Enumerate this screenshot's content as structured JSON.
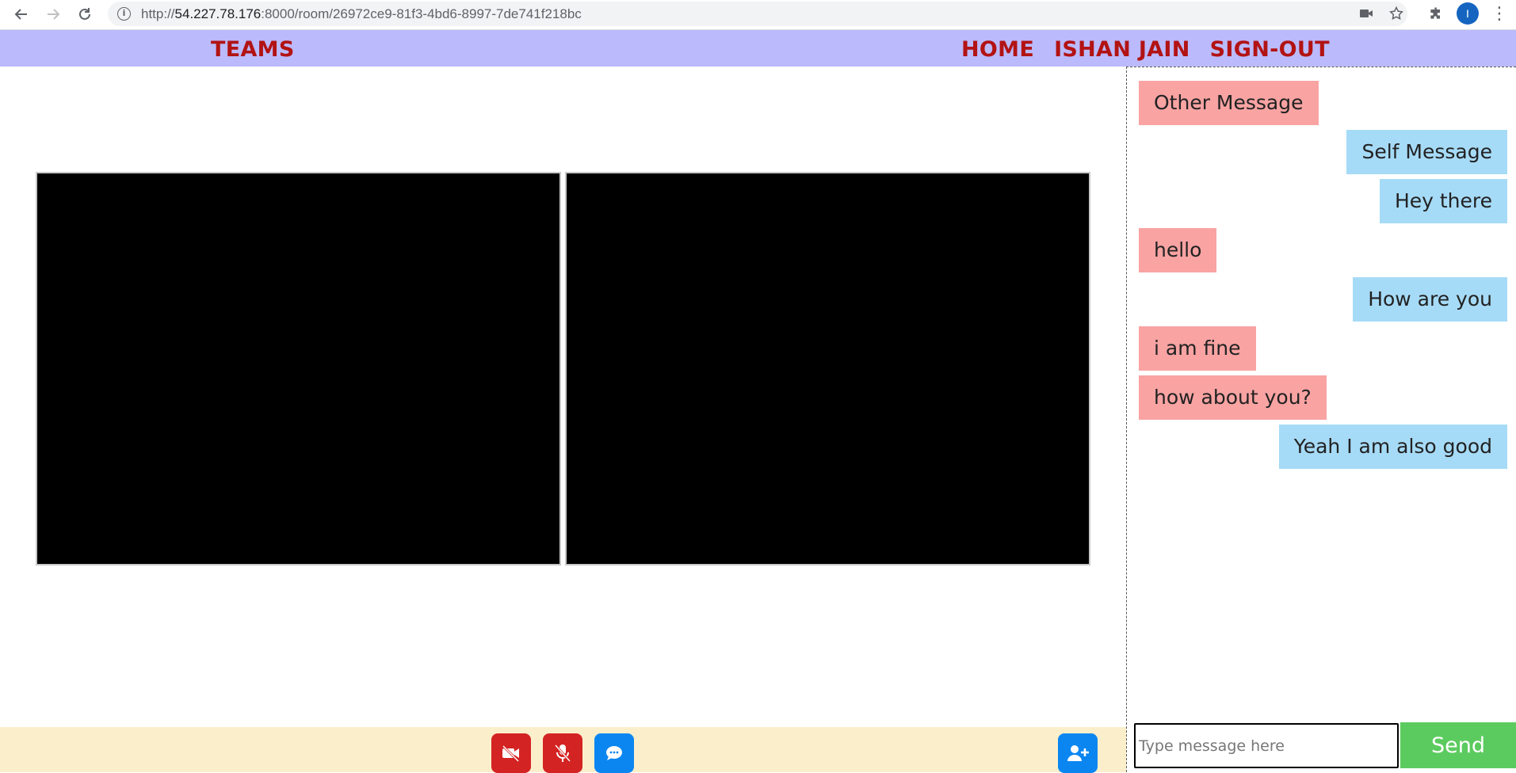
{
  "browser": {
    "url_protocol": "http://",
    "url_host": "54.227.78.176",
    "url_rest": ":8000/room/26972ce9-81f3-4bd6-8997-7de741f218bc",
    "profile_initial": "I",
    "icons": [
      "back-icon",
      "forward-icon",
      "reload-icon",
      "info-icon",
      "camera-icon",
      "star-icon",
      "puzzle-icon",
      "menu-icon"
    ]
  },
  "header": {
    "brand": "TEAMS",
    "nav": {
      "home": "HOME",
      "user": "ISHAN JAIN",
      "signout": "SIGN-OUT"
    },
    "accent_color": "#b21313",
    "background_color": "#bbbafc"
  },
  "videos": [
    {
      "label": ""
    },
    {
      "label": ""
    }
  ],
  "controls": {
    "buttons": [
      {
        "name": "video-off",
        "icon": "video-slash-icon",
        "color": "#d42323"
      },
      {
        "name": "mic-off",
        "icon": "microphone-slash-icon",
        "color": "#d42323"
      },
      {
        "name": "chat",
        "icon": "chat-bubble-icon",
        "color": "#0b86f1"
      },
      {
        "name": "add-user",
        "icon": "user-plus-icon",
        "color": "#0b86f1"
      }
    ],
    "background_color": "#fbefcb"
  },
  "chat": {
    "messages": [
      {
        "text": "Other Message",
        "from": "other"
      },
      {
        "text": "Self Message",
        "from": "self"
      },
      {
        "text": "Hey there",
        "from": "self"
      },
      {
        "text": "hello",
        "from": "other"
      },
      {
        "text": "How are you",
        "from": "self"
      },
      {
        "text": "i am fine",
        "from": "other"
      },
      {
        "text": "how about you?",
        "from": "other"
      },
      {
        "text": "Yeah I am also good",
        "from": "self"
      }
    ],
    "input_placeholder": "Type message here",
    "input_value": "",
    "send_label": "Send",
    "other_color": "#f9a3a3",
    "self_color": "#a6dbf7",
    "send_color": "#5ccb5f"
  }
}
